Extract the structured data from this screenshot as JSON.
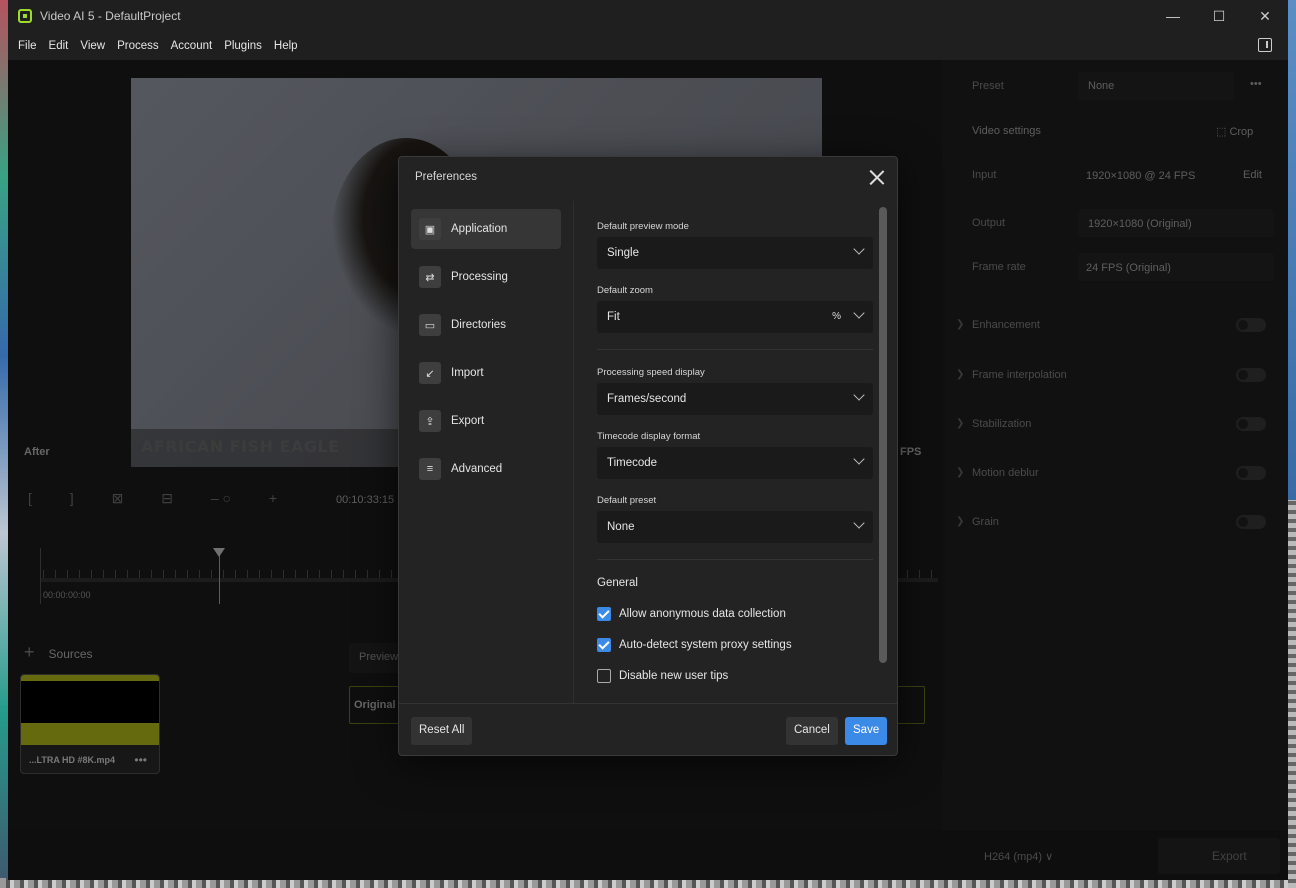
{
  "window": {
    "title": "Video AI 5 - DefaultProject",
    "controls": [
      "minimize-icon",
      "maximize-icon",
      "close-icon"
    ]
  },
  "menu": [
    "File",
    "Edit",
    "View",
    "Process",
    "Account",
    "Plugins",
    "Help"
  ],
  "preview": {
    "caption": "AFRICAN FISH EAGLE",
    "after_label": "After",
    "fps_label": "FPS",
    "timecode": "00:10:33:15",
    "timeline_start": "00:00:00:00"
  },
  "sources": {
    "label": "Sources",
    "clip_name": "...LTRA HD #8K.mp4",
    "clip_more": "•••",
    "preview_tab": "Preview",
    "original_label": "Original"
  },
  "right_panel": {
    "preset_label": "Preset",
    "preset_value": "None",
    "preset_more": "•••",
    "video_settings": "Video settings",
    "crop": "Crop",
    "input_label": "Input",
    "input_value": "1920×1080 @ 24 FPS",
    "input_edit": "Edit",
    "output_label": "Output",
    "output_value": "1920×1080 (Original)",
    "framerate_label": "Frame rate",
    "framerate_value": "24 FPS (Original)",
    "toggles": [
      "Enhancement",
      "Frame interpolation",
      "Stabilization",
      "Motion deblur",
      "Grain"
    ]
  },
  "bottom": {
    "codec": "H264 (mp4)",
    "export": "Export"
  },
  "dialog": {
    "title": "Preferences",
    "nav": [
      {
        "label": "Application",
        "icon": "monitor-icon",
        "active": true
      },
      {
        "label": "Processing",
        "icon": "processing-icon",
        "active": false
      },
      {
        "label": "Directories",
        "icon": "folder-icon",
        "active": false
      },
      {
        "label": "Import",
        "icon": "import-icon",
        "active": false
      },
      {
        "label": "Export",
        "icon": "export-icon",
        "active": false
      },
      {
        "label": "Advanced",
        "icon": "sliders-icon",
        "active": false
      }
    ],
    "fields": {
      "preview_mode_label": "Default preview mode",
      "preview_mode_value": "Single",
      "zoom_label": "Default zoom",
      "zoom_value": "Fit",
      "zoom_unit": "%",
      "speed_label": "Processing speed display",
      "speed_value": "Frames/second",
      "timecode_label": "Timecode display format",
      "timecode_value": "Timecode",
      "preset_label": "Default preset",
      "preset_value": "None"
    },
    "general": {
      "heading": "General",
      "checkboxes": [
        {
          "label": "Allow anonymous data collection",
          "checked": true
        },
        {
          "label": "Auto-detect system proxy settings",
          "checked": true
        },
        {
          "label": "Disable new user tips",
          "checked": false
        }
      ]
    },
    "buttons": {
      "reset": "Reset All",
      "cancel": "Cancel",
      "save": "Save"
    },
    "accent": "#3b8ae8"
  }
}
